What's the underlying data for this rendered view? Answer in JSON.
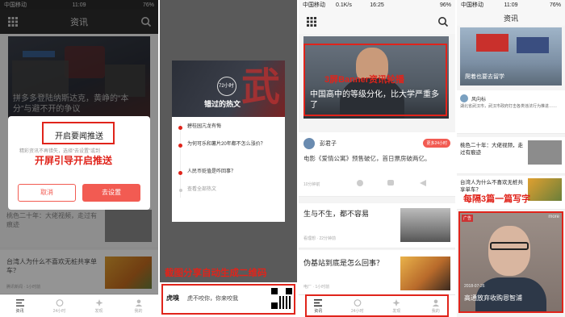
{
  "colors": {
    "accent": "#e0241b",
    "button_red": "#f25b52",
    "dark_bg": "#555555"
  },
  "p1": {
    "status": {
      "left": "中国移动",
      "time": "11:09",
      "right": "76%"
    },
    "title": "资讯",
    "hero_text": "拼多多登陆纳斯达克，黄峥的“本分”与避不开的争议",
    "dialog": {
      "title": "开启要闻推送",
      "body": "精彩资讯不再错失，选择“去设置”或到",
      "cancel": "取消",
      "confirm": "去设置"
    },
    "annotation": "开屏引导开启推送",
    "list": [
      {
        "title": "桃色二十年：大佬视频，走过有痕迹",
        "meta": "新华社"
      },
      {
        "title": "台湾人为什么不喜欢无桩共享单车？",
        "meta": "腾讯新闻 · 1小时前"
      }
    ],
    "tabs": [
      "资讯",
      "24小时",
      "发现",
      "我的"
    ]
  },
  "p2": {
    "badge": "72小时",
    "banner": "错过的热文",
    "items": [
      "碧桂园亢龙有悔",
      "为何可乐和薯片20年都不怎么涨价？",
      "人民币贬值是咋回事？"
    ],
    "see_all": "查看全部热文",
    "annotation": "截图分享自动生成二维码",
    "footer_logo": "虎嗅",
    "footer_text": "虎不咬你，你来咬我"
  },
  "p3": {
    "status": {
      "left": "中国移动",
      "speed": "0.1K/s",
      "time": "16:25",
      "right": "96%"
    },
    "hero_caption": "中国高中的等级分化，比大学严重多了",
    "annotation": "3屏Banner资讯轮播",
    "author": "彭君子",
    "badge": "更多24小时",
    "post_text": "电影《爱情公寓》预售破亿，首日票房破两亿。",
    "post_meta": "10分钟前",
    "items": [
      {
        "title": "生与不生，都不容易",
        "meta": "看理想 · 22分钟前"
      },
      {
        "title": "伪基站到底是怎么回事？",
        "meta": "电厂 · 1小时前"
      }
    ],
    "tabs": [
      "资讯",
      "24小时",
      "发现",
      "我的"
    ]
  },
  "p4": {
    "status": {
      "left": "中国移动",
      "time": "11:09",
      "right": "76%"
    },
    "title": "资讯",
    "top_caption": "爬着也要去留学",
    "author": "风向标",
    "post_text": "湖北省武汉市，武汉市政府打击各类违法行为推进……",
    "list": [
      {
        "title": "桃色二十年：大佬视频，走过有痕迹",
        "meta": "新华社"
      },
      {
        "title": "台湾人为什么不喜欢无桩共享单车？",
        "meta": "腾讯新闻"
      }
    ],
    "annotation": "每隔3篇一篇写字",
    "ad_tag": "广告",
    "ad_more": "more",
    "ad_meta": "2018-07-26",
    "ad_caption": "高通放弃收购恩智浦"
  }
}
